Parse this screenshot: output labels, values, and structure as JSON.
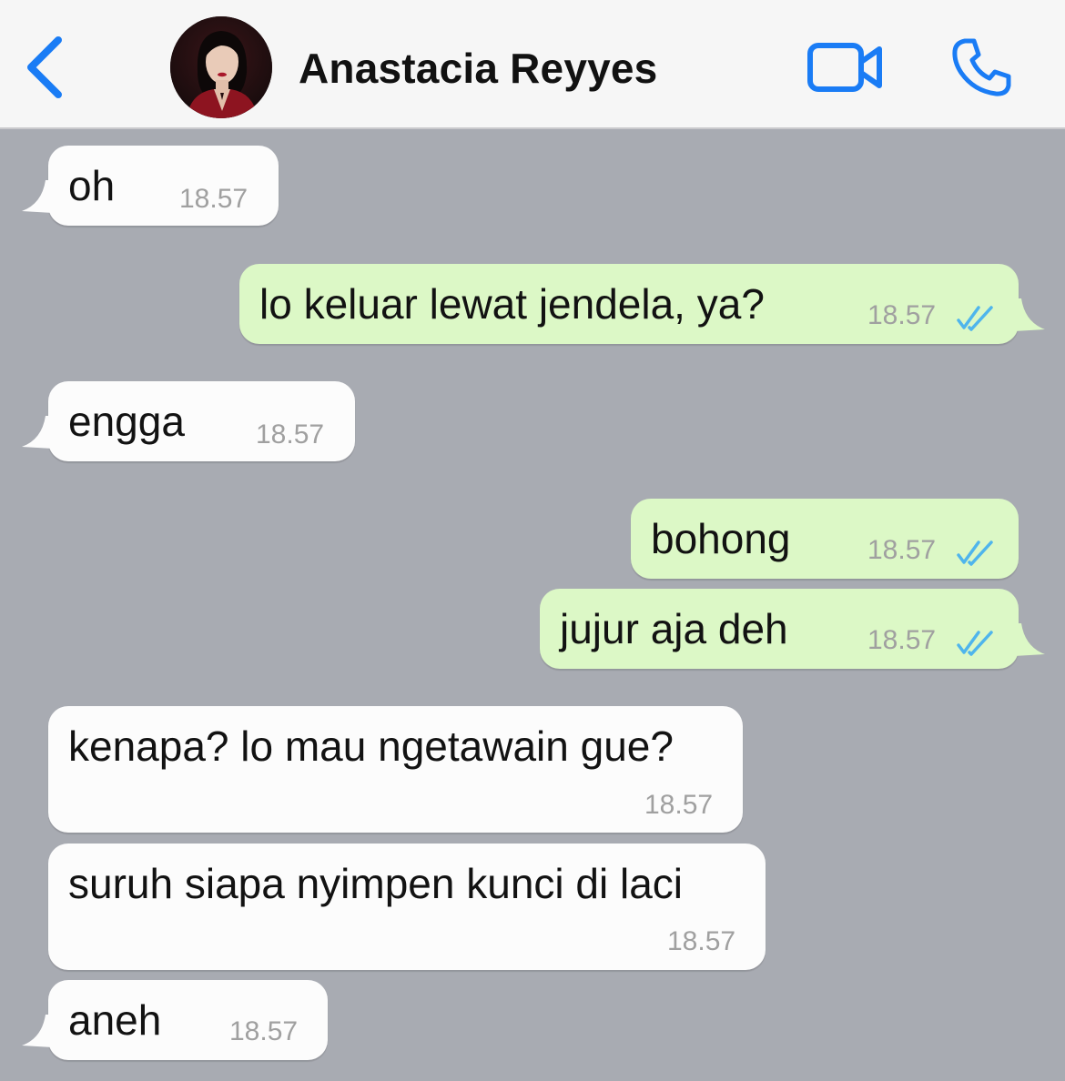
{
  "header": {
    "back_icon": "chevron-left-icon",
    "contact_name": "Anastacia Reyyes",
    "video_icon": "video-camera-icon",
    "phone_icon": "phone-icon",
    "accent_color": "#1a7cf5"
  },
  "colors": {
    "chat_background": "#a8abb2",
    "incoming_bubble": "#fcfcfc",
    "outgoing_bubble": "#dcf8c6",
    "read_ticks": "#4fb5ec"
  },
  "messages": [
    {
      "direction": "in",
      "text": "oh",
      "time": "18.57"
    },
    {
      "direction": "out",
      "text": "lo keluar lewat jendela, ya?",
      "time": "18.57",
      "status": "read"
    },
    {
      "direction": "in",
      "text": "engga",
      "time": "18.57"
    },
    {
      "direction": "out",
      "text": "bohong",
      "time": "18.57",
      "status": "read"
    },
    {
      "direction": "out",
      "text": "jujur aja deh",
      "time": "18.57",
      "status": "read"
    },
    {
      "direction": "in",
      "text": "kenapa? lo mau ngetawain gue?",
      "time": "18.57"
    },
    {
      "direction": "in",
      "text": "suruh siapa nyimpen kunci di laci",
      "time": "18.57"
    },
    {
      "direction": "in",
      "text": "aneh",
      "time": "18.57"
    }
  ]
}
